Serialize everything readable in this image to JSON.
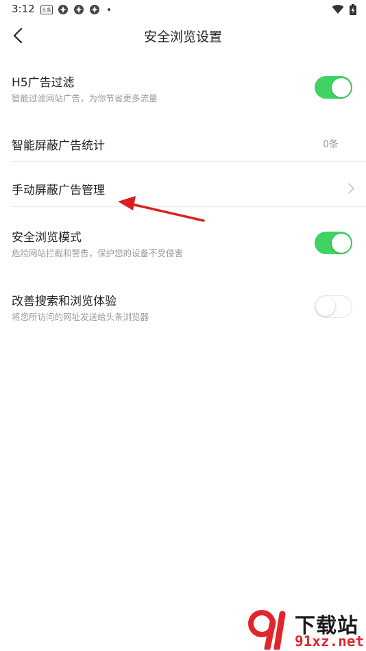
{
  "status_bar": {
    "time": "3:12",
    "news_icon_text": "头条"
  },
  "header": {
    "title": "安全浏览设置"
  },
  "settings": [
    {
      "title": "H5广告过滤",
      "subtitle": "智能过滤网站广告，为你节省更多流量",
      "toggle": true
    },
    {
      "title": "智能屏蔽广告统计",
      "value": "0条"
    },
    {
      "title": "手动屏蔽广告管理"
    },
    {
      "title": "安全浏览模式",
      "subtitle": "危险网站拦截和警告，保护您的设备不受侵害",
      "toggle": true
    },
    {
      "title": "改善搜索和浏览体验",
      "subtitle": "将您所访问的网址发送给头条浏览器",
      "toggle": false
    }
  ],
  "watermark": {
    "line1": "下载站",
    "line2": "91xz.net"
  },
  "colors": {
    "toggle_on": "#3ed363",
    "annotation_arrow": "#d91f1f",
    "watermark_red": "#e0262c"
  }
}
